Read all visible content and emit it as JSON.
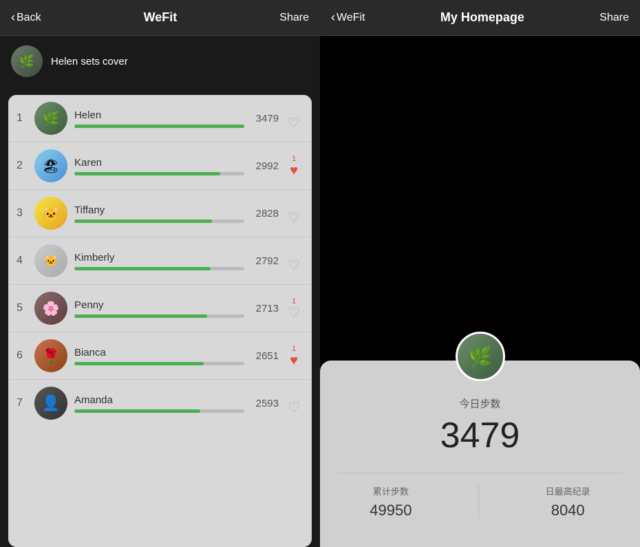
{
  "left": {
    "nav": {
      "back_label": "Back",
      "title": "WeFit",
      "share_label": "Share"
    },
    "cover": {
      "text": "Helen sets cover"
    },
    "leaderboard": [
      {
        "rank": "1",
        "name": "Helen",
        "steps": "3479",
        "progress": 100,
        "heart_count": "",
        "heart_active": false
      },
      {
        "rank": "2",
        "name": "Karen",
        "steps": "2992",
        "progress": 86,
        "heart_count": "1",
        "heart_active": true
      },
      {
        "rank": "3",
        "name": "Tiffany",
        "steps": "2828",
        "progress": 81,
        "heart_count": "",
        "heart_active": false
      },
      {
        "rank": "4",
        "name": "Kimberly",
        "steps": "2792",
        "progress": 80,
        "heart_count": "",
        "heart_active": false
      },
      {
        "rank": "5",
        "name": "Penny",
        "steps": "2713",
        "progress": 78,
        "heart_count": "1",
        "heart_active": false
      },
      {
        "rank": "6",
        "name": "Bianca",
        "steps": "2651",
        "progress": 76,
        "heart_count": "1",
        "heart_active": true
      },
      {
        "rank": "7",
        "name": "Amanda",
        "steps": "2593",
        "progress": 74,
        "heart_count": "",
        "heart_active": false
      }
    ]
  },
  "right": {
    "nav": {
      "back_label": "WeFit",
      "title": "My Homepage",
      "share_label": "Share"
    },
    "homepage": {
      "today_label": "今日步数",
      "today_steps": "3479",
      "cumulative_label": "累计步数",
      "cumulative_value": "49950",
      "record_label": "日最高纪录",
      "record_value": "8040"
    }
  },
  "avatars": {
    "helen_emoji": "🌿",
    "karen_emoji": "🏖",
    "tiffany_emoji": "🐱",
    "kimberly_emoji": "🐱",
    "penny_emoji": "🌸",
    "bianca_emoji": "🌹",
    "amanda_emoji": "👤"
  }
}
